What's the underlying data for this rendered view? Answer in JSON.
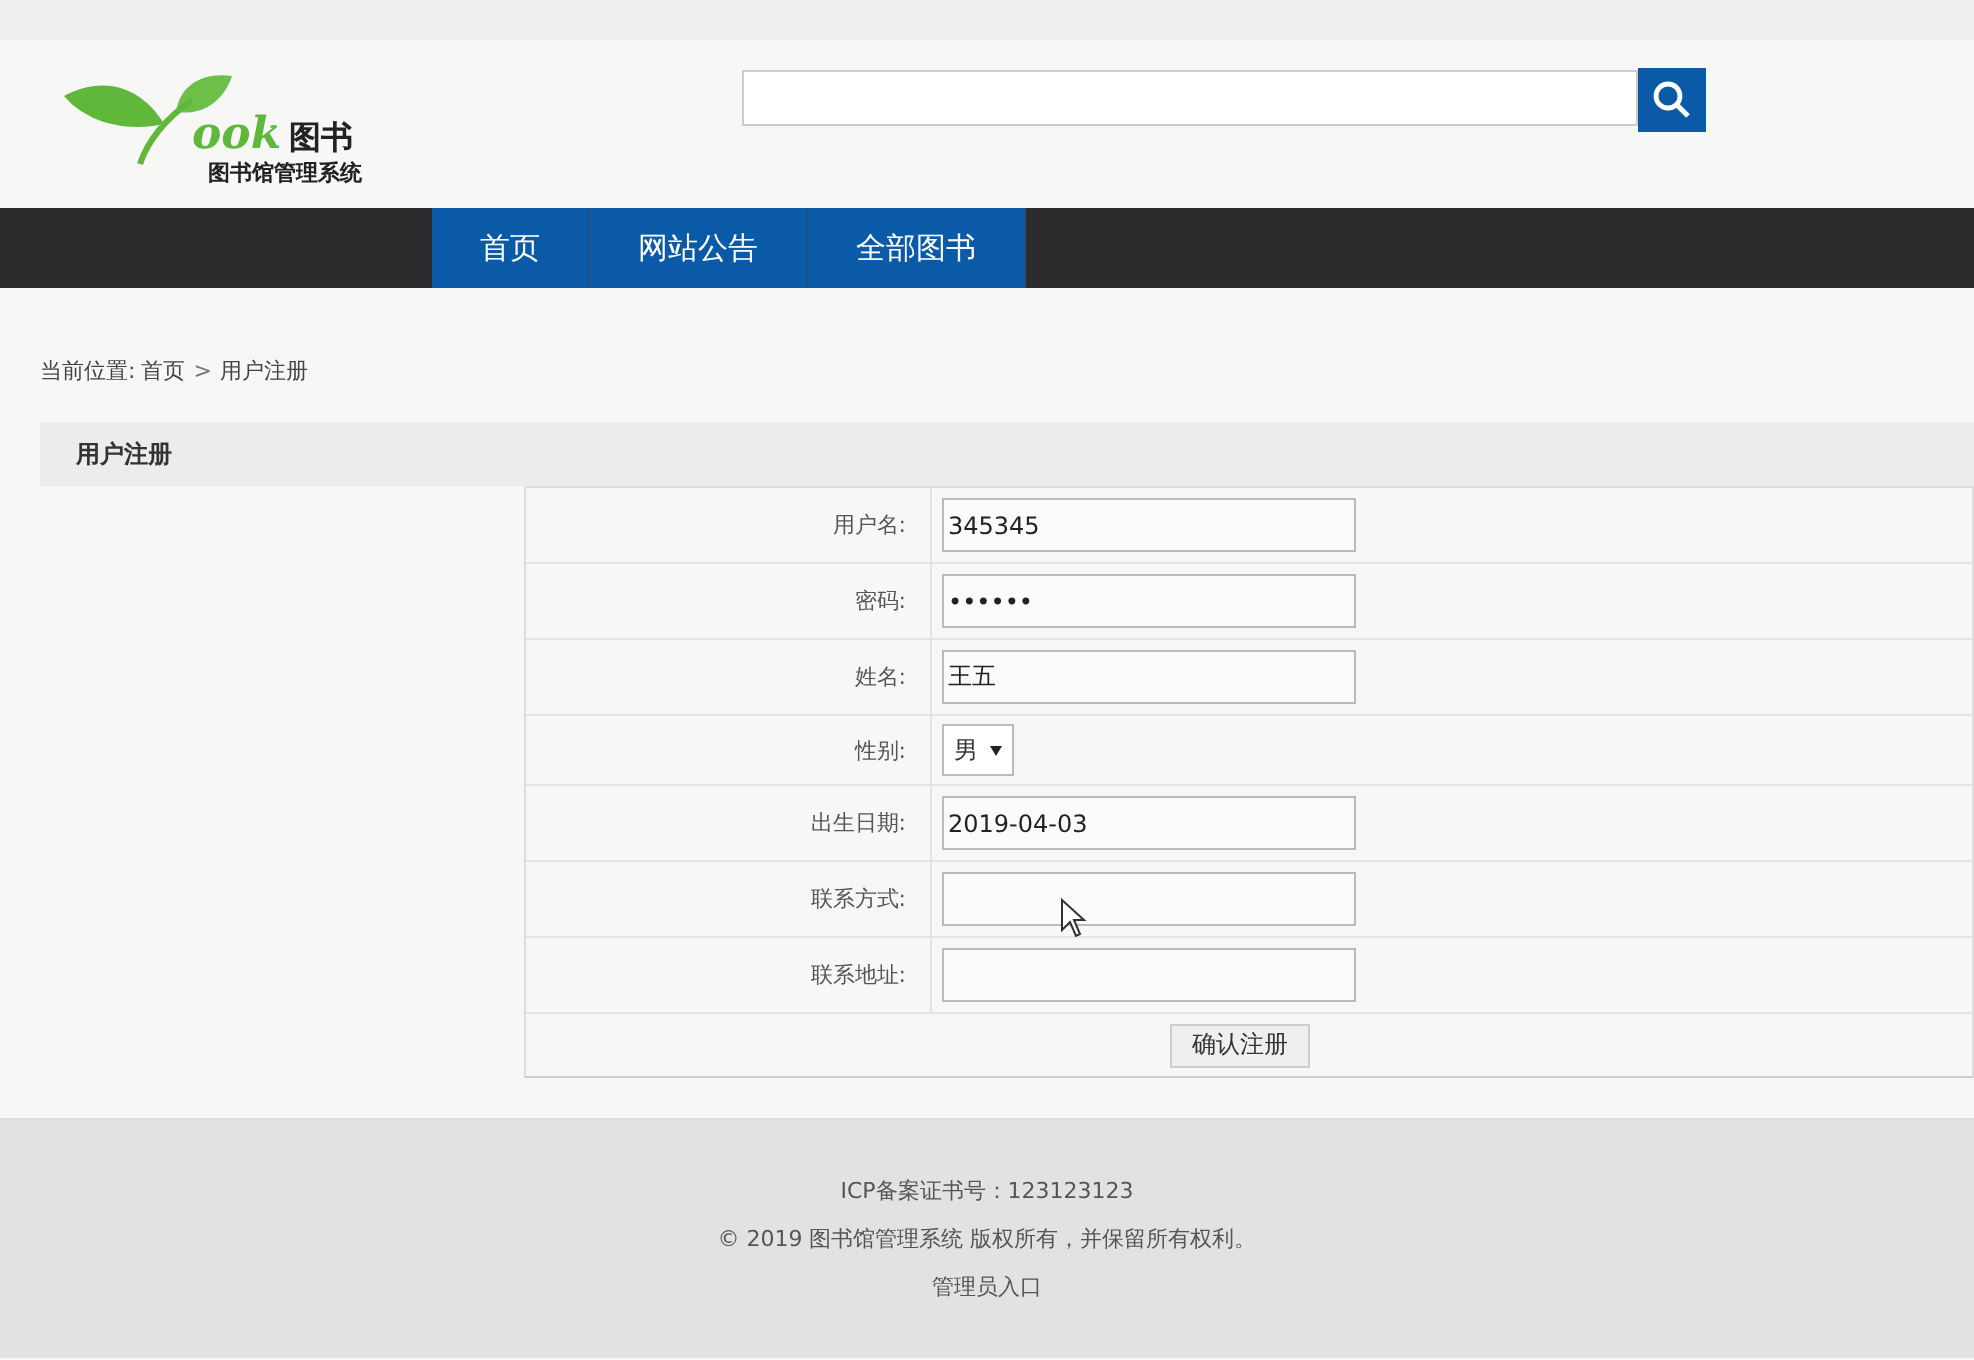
{
  "logo": {
    "mark": "ook",
    "title": "图书",
    "subtitle": "图书馆管理系统"
  },
  "nav": [
    {
      "label": "首页"
    },
    {
      "label": "网站公告"
    },
    {
      "label": "全部图书"
    }
  ],
  "breadcrumb": {
    "prefix": "当前位置:",
    "items": [
      "首页",
      "用户注册"
    ],
    "separator": ">"
  },
  "section": {
    "title": "用户注册"
  },
  "form": {
    "fields": [
      {
        "kind": "text",
        "label": "用户名:",
        "value": "345345"
      },
      {
        "kind": "text",
        "label": "密码:",
        "value": "••••••"
      },
      {
        "kind": "text",
        "label": "姓名:",
        "value": "王五"
      },
      {
        "kind": "select",
        "label": "性别:",
        "value": "男"
      },
      {
        "kind": "text",
        "label": "出生日期:",
        "value": "2019-04-03"
      },
      {
        "kind": "text",
        "label": "联系方式:"
      },
      {
        "kind": "text",
        "label": "联系地址:"
      }
    ],
    "submit": "确认注册"
  },
  "footer": {
    "icp": "ICP备案证书号：123123123",
    "copyright": "© 2019 图书馆管理系统 版权所有，并保留所有权利。",
    "admin_link": "管理员入口"
  }
}
